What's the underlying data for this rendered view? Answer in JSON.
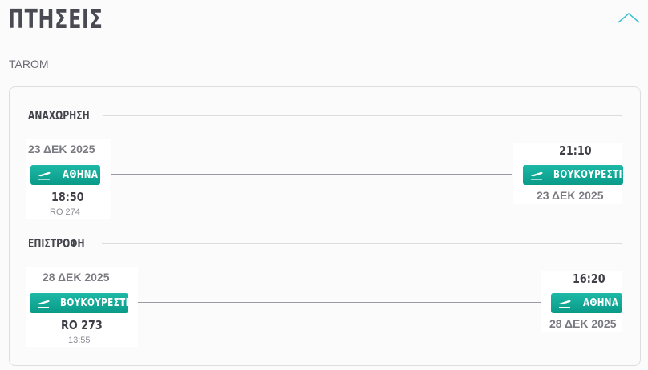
{
  "page": {
    "title": "ΠΤΗΣΕΙΣ",
    "collapse_icon": "chevron-up-icon",
    "accent": "#3ec3d6"
  },
  "airline": "TAROM",
  "badge_color": "#12a996",
  "outbound": {
    "label": "ΑΝΑΧΩΡΗΣΗ",
    "depart": {
      "date": "23 ΔΕΚ 2025",
      "city": "ΑΘΗΝΑ",
      "time": "18:50",
      "flight": "RO 274",
      "icon": "plane-takeoff-icon"
    },
    "arrive": {
      "time": "21:10",
      "city": "ΒΟΥΚΟΥΡΕΣΤΙ",
      "date": "23 ΔΕΚ 2025",
      "icon": "plane-takeoff-icon"
    }
  },
  "return": {
    "label": "ΕΠΙΣΤΡΟΦΗ",
    "depart": {
      "date": "28 ΔΕΚ 2025",
      "city": "ΒΟΥΚΟΥΡΕΣΤΙ",
      "flight": "RO 273",
      "time": "13:55",
      "icon": "plane-takeoff-icon"
    },
    "arrive": {
      "time": "16:20",
      "city": "ΑΘΗΝΑ",
      "date": "28 ΔΕΚ 2025",
      "icon": "plane-takeoff-icon"
    }
  }
}
